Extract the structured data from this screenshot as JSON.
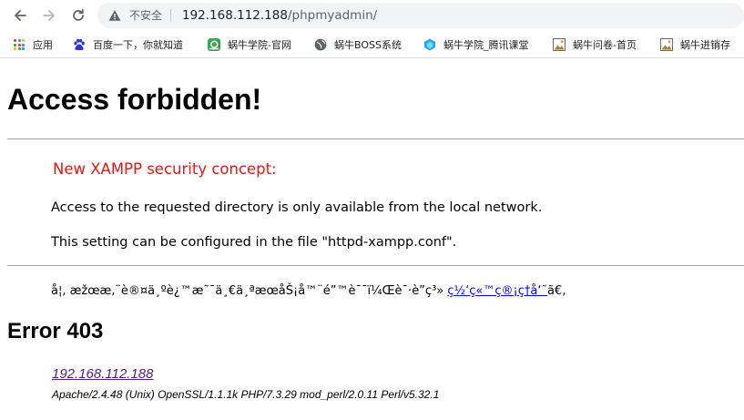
{
  "browser": {
    "nav": {
      "back_icon": "arrow-left-icon",
      "forward_icon": "arrow-right-icon",
      "reload_icon": "reload-icon"
    },
    "omnibox": {
      "security_icon": "warning-triangle-icon",
      "security_label": "不安全",
      "host": "192.168.112.188",
      "path": "/phpmyadmin/"
    },
    "bookmarks": [
      {
        "label": "应用",
        "icon": "apps-grid-icon"
      },
      {
        "label": "百度一下，你就知道",
        "icon": "baidu-paw-icon"
      },
      {
        "label": "蜗牛学院-官网",
        "icon": "green-snail-icon"
      },
      {
        "label": "蜗牛BOSS系统",
        "icon": "globe-icon"
      },
      {
        "label": "蜗牛学院_腾讯课堂",
        "icon": "tencent-classroom-icon"
      },
      {
        "label": "蜗牛问卷-首页",
        "icon": "page-image-icon"
      },
      {
        "label": "蜗牛进销存",
        "icon": "page-image-icon"
      }
    ]
  },
  "page": {
    "title": "Access forbidden!",
    "concept": "New XAMPP security concept:",
    "paragraph1": "Access to the requested directory is only available from the local network.",
    "paragraph2": "This setting can be configured in the file \"httpd-xampp.conf\".",
    "garbled_text": "å¦, æžœæ‚¨è®¤ä¸ºè¿™æ˜¯ä¸€ä¸ªæœåŠ¡å™¨é”™è¯¯ï¼Œè¯·è”ç³»",
    "garbled_link": "ç½‘ç«™ç®¡ç†å‘˜",
    "garbled_tail": "ã€‚",
    "error_heading": "Error 403",
    "server_address": "192.168.112.188",
    "server_signature": "Apache/2.4.48 (Unix) OpenSSL/1.1.1k PHP/7.3.29 mod_perl/2.0.11 Perl/v5.32.1"
  },
  "colors": {
    "concept_red": "#e8180c",
    "link_blue": "#0000ee",
    "visited_purple": "#551a8b",
    "omnibox_bg": "#f1f3f4"
  }
}
